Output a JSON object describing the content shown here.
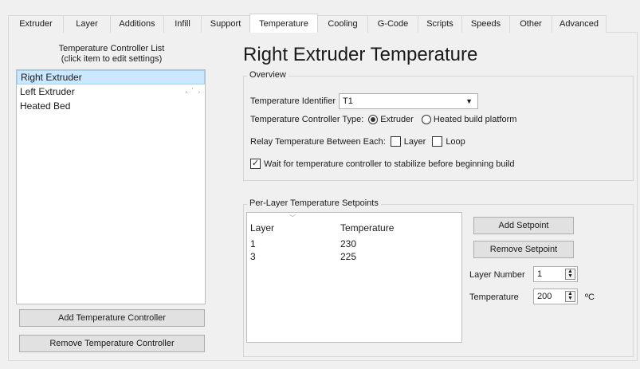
{
  "tabs": [
    {
      "label": "Extruder",
      "width": 70
    },
    {
      "label": "Layer",
      "width": 60
    },
    {
      "label": "Additions",
      "width": 68
    },
    {
      "label": "Infill",
      "width": 48
    },
    {
      "label": "Support",
      "width": 62
    },
    {
      "label": "Temperature",
      "width": 86,
      "active": true
    },
    {
      "label": "Cooling",
      "width": 64
    },
    {
      "label": "G-Code",
      "width": 64
    },
    {
      "label": "Scripts",
      "width": 56
    },
    {
      "label": "Speeds",
      "width": 61
    },
    {
      "label": "Other",
      "width": 54
    },
    {
      "label": "Advanced",
      "width": 69
    }
  ],
  "controllers": {
    "title_line1": "Temperature Controller List",
    "title_line2": "(click item to edit settings)",
    "items": [
      "Right Extruder",
      "Left Extruder",
      "Heated Bed"
    ],
    "selected_index": 0,
    "add_label": "Add Temperature Controller",
    "remove_label": "Remove Temperature Controller"
  },
  "heading": "Right Extruder Temperature",
  "overview": {
    "title": "Overview",
    "identifier_label": "Temperature Identifier",
    "identifier_value": "T1",
    "type_label": "Temperature Controller Type:",
    "type_options": [
      "Extruder",
      "Heated build platform"
    ],
    "type_selected": "Extruder",
    "relay_label": "Relay Temperature Between Each:",
    "relay_layer": "Layer",
    "relay_loop": "Loop",
    "wait_label": "Wait for temperature controller to stabilize before beginning build",
    "wait_checked": true
  },
  "setpoints": {
    "title": "Per-Layer Temperature Setpoints",
    "columns": [
      "Layer",
      "Temperature"
    ],
    "rows": [
      [
        "1",
        "230"
      ],
      [
        "3",
        "225"
      ]
    ],
    "add_label": "Add Setpoint",
    "remove_label": "Remove Setpoint",
    "layer_number_label": "Layer Number",
    "layer_number_value": "1",
    "temperature_label": "Temperature",
    "temperature_value": "200",
    "unit": "ºC"
  }
}
